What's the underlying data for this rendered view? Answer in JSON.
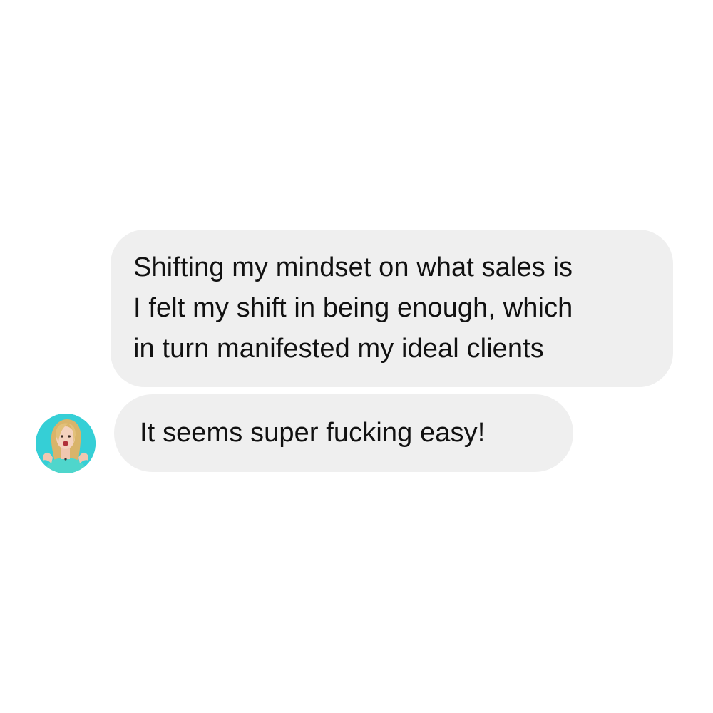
{
  "conversation": {
    "messages": [
      {
        "lines": [
          "Shifting my mindset on what sales is",
          "I felt my shift in being enough, which",
          "in turn manifested my ideal clients"
        ]
      },
      {
        "lines": [
          "It seems super fucking easy!"
        ]
      }
    ],
    "avatar": {
      "icon": "profile-photo-avatar",
      "background_color": "#35cfd6"
    },
    "bubble_color": "#efefef"
  }
}
